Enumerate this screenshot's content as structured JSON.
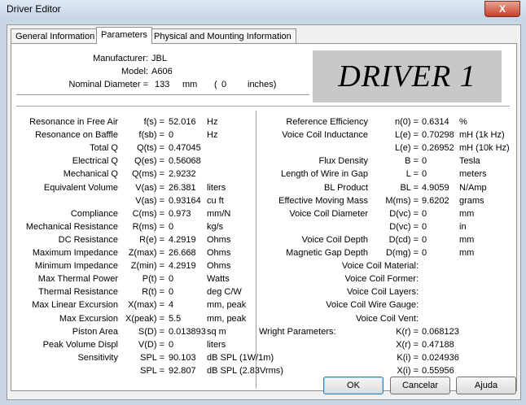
{
  "window": {
    "title": "Driver Editor",
    "close_glyph": "X"
  },
  "tabs": [
    {
      "label": "General Information"
    },
    {
      "label": "Parameters"
    },
    {
      "label": "Physical and Mounting Information"
    }
  ],
  "header": {
    "manufacturer_label": "Manufacturer:",
    "manufacturer": "JBL",
    "model_label": "Model:",
    "model": "A606",
    "diameter_label": "Nominal Diameter =",
    "diameter_value": "133",
    "diameter_unit": "mm",
    "diameter_open": "(",
    "diameter_inches": "0",
    "diameter_inches_unit": "inches)",
    "logo_text": "DRIVER 1"
  },
  "left_params": [
    {
      "label": "Resonance in Free Air",
      "sym": "f(s) =",
      "val": "52.016",
      "unit": "Hz"
    },
    {
      "label": "Resonance on Baffle",
      "sym": "f(sb) =",
      "val": "0",
      "unit": "Hz"
    },
    {
      "label": "Total Q",
      "sym": "Q(ts) =",
      "val": "0.47045",
      "unit": ""
    },
    {
      "label": "Electrical Q",
      "sym": "Q(es) =",
      "val": "0.56068",
      "unit": ""
    },
    {
      "label": "Mechanical Q",
      "sym": "Q(ms) =",
      "val": "2.9232",
      "unit": ""
    },
    {
      "label": "Equivalent Volume",
      "sym": "V(as) =",
      "val": "26.381",
      "unit": "liters"
    },
    {
      "label": "",
      "sym": "V(as) =",
      "val": "0.93164",
      "unit": "cu ft"
    },
    {
      "label": "Compliance",
      "sym": "C(ms) =",
      "val": "0.973",
      "unit": "mm/N"
    },
    {
      "label": "Mechanical Resistance",
      "sym": "R(ms) =",
      "val": "0",
      "unit": "kg/s"
    },
    {
      "label": "DC Resistance",
      "sym": "R(e) =",
      "val": "4.2919",
      "unit": "Ohms"
    },
    {
      "label": "Maximum Impedance",
      "sym": "Z(max) =",
      "val": "26.668",
      "unit": "Ohms"
    },
    {
      "label": "Minimum Impedance",
      "sym": "Z(min) =",
      "val": "4.2919",
      "unit": "Ohms"
    },
    {
      "label": "Max Thermal Power",
      "sym": "P(t) =",
      "val": "0",
      "unit": "Watts"
    },
    {
      "label": "Thermal Resistance",
      "sym": "R(t) =",
      "val": "0",
      "unit": "deg C/W"
    },
    {
      "label": "Max Linear Excursion",
      "sym": "X(max) =",
      "val": "4",
      "unit": "mm, peak"
    },
    {
      "label": "Max Excursion",
      "sym": "X(peak) =",
      "val": "5.5",
      "unit": "mm, peak"
    },
    {
      "label": "Piston Area",
      "sym": "S(D) =",
      "val": "0.013893",
      "unit": "sq m"
    },
    {
      "label": "Peak Volume Displ",
      "sym": "V(D) =",
      "val": "0",
      "unit": "liters"
    },
    {
      "label": "Sensitivity",
      "sym": "SPL =",
      "val": "90.103",
      "unit": "dB SPL (1W/1m)"
    },
    {
      "label": "",
      "sym": "SPL =",
      "val": "92.807",
      "unit": "dB SPL (2.83Vrms)"
    }
  ],
  "right_params": [
    {
      "label": "Reference Efficiency",
      "sym": "n(0) =",
      "val": "0.6314",
      "unit": "%"
    },
    {
      "label": "Voice Coil Inductance",
      "sym": "L(e) =",
      "val": "0.70298",
      "unit": "mH (1k Hz)"
    },
    {
      "label": "",
      "sym": "L(e) =",
      "val": "0.26952",
      "unit": "mH (10k Hz)"
    },
    {
      "label": "Flux Density",
      "sym": "B =",
      "val": "0",
      "unit": "Tesla"
    },
    {
      "label": "Length of Wire in Gap",
      "sym": "L =",
      "val": "0",
      "unit": "meters"
    },
    {
      "label": "BL Product",
      "sym": "BL =",
      "val": "4.9059",
      "unit": "N/Amp"
    },
    {
      "label": "Effective Moving Mass",
      "sym": "M(ms) =",
      "val": "9.6202",
      "unit": "grams"
    },
    {
      "label": "Voice Coil Diameter",
      "sym": "D(vc) =",
      "val": "0",
      "unit": "mm"
    },
    {
      "label": "",
      "sym": "D(vc) =",
      "val": "0",
      "unit": "in"
    },
    {
      "label": "Voice Coil Depth",
      "sym": "D(cd) =",
      "val": "0",
      "unit": "mm"
    },
    {
      "label": "Magnetic Gap Depth",
      "sym": "D(mg) =",
      "val": "0",
      "unit": "mm"
    }
  ],
  "voice_coil_text": [
    {
      "label": "Voice Coil Material:"
    },
    {
      "label": "Voice Coil Former:"
    },
    {
      "label": "Voice Coil Layers:"
    },
    {
      "label": "Voice Coil Wire Gauge:"
    },
    {
      "label": "Voice Coil Vent:"
    }
  ],
  "wright": {
    "title": "Wright Parameters:",
    "rows": [
      {
        "sym": "K(r) =",
        "val": "0.068123"
      },
      {
        "sym": "X(r) =",
        "val": "0.47188"
      },
      {
        "sym": "K(i) =",
        "val": "0.024936"
      },
      {
        "sym": "X(i) =",
        "val": "0.55956"
      }
    ]
  },
  "buttons": {
    "ok": "OK",
    "cancel": "Cancelar",
    "help": "Ajuda"
  }
}
